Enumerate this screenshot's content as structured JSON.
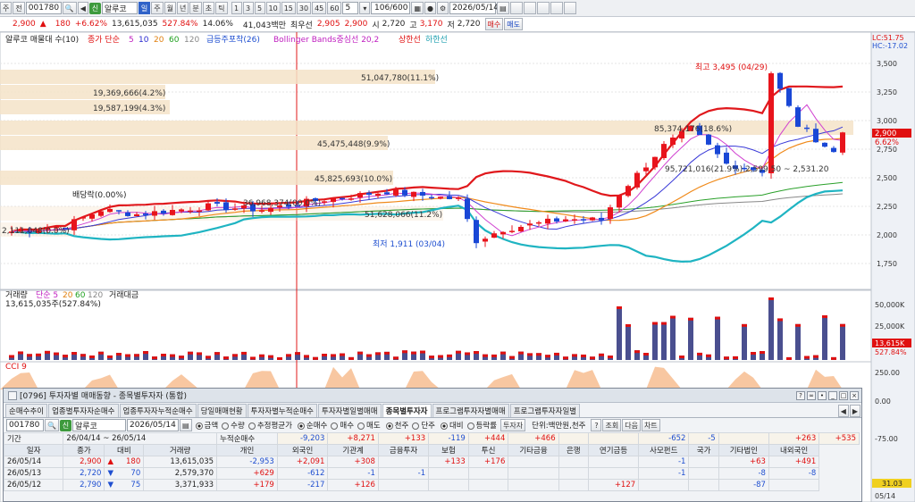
{
  "toolbar": {
    "code": "001780",
    "name": "알루코",
    "badge": "신",
    "period_tabs": [
      "일",
      "주",
      "월",
      "년",
      "분",
      "초",
      "틱"
    ],
    "minute_buttons": [
      "1",
      "3",
      "5",
      "10",
      "15",
      "30",
      "45",
      "60"
    ],
    "count": "5",
    "page": "106/600",
    "date": "2026/05/14",
    "buttons_left": [
      "주",
      "전"
    ]
  },
  "price": {
    "close": "2,900",
    "change_arrow": "▲",
    "change": "180",
    "change_pct": "+6.62%",
    "volume": "13,615,035",
    "vol_ratio": "527.84%",
    "turnover": "14.06%",
    "amount": "41,043백만",
    "label_low": "최우선",
    "bid": "2,905",
    "ask": "2,900",
    "open_label": "시",
    "open": "2,720",
    "high_label": "고",
    "high": "3,170",
    "low_label": "저",
    "low": "2,720",
    "buy_btn": "매수",
    "sell_btn": "매도"
  },
  "legend": {
    "main": "알루코 매물대 수(10)",
    "ma_label": "종가 단순",
    "ma": [
      "5",
      "10",
      "20",
      "60",
      "120"
    ],
    "ind1": "급등주포착(26)",
    "bb": "Bollinger Bands중심선 20,2",
    "bb_up": "상한선",
    "bb_dn": "하한선",
    "lc": "LC:51.75",
    "hc": "HC:-17.02"
  },
  "annotations": {
    "high": "최고 3,495 (04/29)",
    "low": "최저 1,911 (03/04)",
    "dividend": "배당락(0.00%)",
    "vp_line": "36,968,374(00.0%)",
    "zone_label": "95,721,016(21.9%) 2,599.50 ~ 2,531.20"
  },
  "volume_profile": [
    {
      "label": "51,047,780(11.1%)"
    },
    {
      "label": "19,369,666(4.2%)"
    },
    {
      "label": "19,587,199(4.3%)"
    },
    {
      "label": "85,374,176(18.6%)"
    },
    {
      "label": "45,475,448(9.9%)"
    },
    {
      "label": "45,825,693(10.0%)"
    },
    {
      "label": "51,628,066(11.2%)"
    },
    {
      "label": "2,111,048(0.0%)"
    }
  ],
  "price_axis": [
    "3,500",
    "3,250",
    "3,000",
    "2,750",
    "2,500",
    "2,250",
    "2,000",
    "1,750"
  ],
  "price_tags": {
    "cur": "2,900",
    "pct": "6.62%"
  },
  "vol_pane": {
    "label": "거래량",
    "ma": "단순 5",
    "ma2": "20",
    "ma3": "60",
    "ma4": "120",
    "amt": "거래대금",
    "value": "13,615,035주(527.84%)",
    "axis": [
      "50,000K",
      "25,000K"
    ],
    "tag": "13,615K",
    "tag2": "527.84%"
  },
  "cci_pane": {
    "label": "CCI 9",
    "axis": [
      "250.00",
      "0.00",
      "-75.00"
    ],
    "tag": "31.03",
    "date": "05/14"
  },
  "panel": {
    "id": "[0796]",
    "title": "투자자별 매매동향 - 종목별투자자 (통합)",
    "tabs": [
      "순매수추이",
      "업종별투자자순매수",
      "업종투자자누적순매수",
      "당일매매현황",
      "투자자별누적순매수",
      "투자자별일별매매",
      "종목별투자자",
      "프로그램투자자별매매",
      "프로그램투자자일별"
    ],
    "code": "001780",
    "name": "알루코",
    "date": "2026/05/14",
    "r1": [
      "금액",
      "수량",
      "추정평균가"
    ],
    "r2": [
      "순매수",
      "매수",
      "매도"
    ],
    "r3": [
      "천주",
      "단주"
    ],
    "r4": [
      "대비",
      "등락률"
    ],
    "inv_btn": "투자자",
    "unit": "단위:백만원,천주",
    "btns": [
      "?",
      "조회",
      "다음",
      "차트"
    ],
    "period_label": "기간",
    "from": "26/04/14",
    "to": "26/05/14",
    "cum_label": "누적순매수",
    "sums": [
      "-9,203",
      "+8,271",
      "+133",
      "-119",
      "+444",
      "+466",
      "",
      "",
      "-652",
      "-5",
      "",
      "+263",
      "+535"
    ],
    "headers": [
      "일자",
      "종가",
      "대비",
      "거래량",
      "개인",
      "외국인",
      "기관계",
      "금융투자",
      "보험",
      "투신",
      "기타금융",
      "은행",
      "연기금등",
      "사모펀드",
      "국가",
      "기타법인",
      "내외국인"
    ],
    "rows": [
      [
        "26/05/14",
        "2,900",
        "▲",
        "180",
        "13,615,035",
        "-2,953",
        "+2,091",
        "+308",
        "",
        "+133",
        "+176",
        "",
        "",
        "",
        "-1",
        "",
        "+63",
        "+491"
      ],
      [
        "26/05/13",
        "2,720",
        "▼",
        "70",
        "2,579,370",
        "+629",
        "-612",
        "-1",
        "-1",
        "",
        "",
        "",
        "",
        "",
        "-1",
        "",
        "-8",
        "-8"
      ],
      [
        "26/05/12",
        "2,790",
        "▼",
        "75",
        "3,371,933",
        "+179",
        "-217",
        "+126",
        "",
        "",
        "",
        "",
        "",
        "+127",
        "",
        "",
        "-87",
        ""
      ]
    ]
  },
  "colors": {
    "up": "#e8141c",
    "down": "#1947d6",
    "bb": "#1fb4c2",
    "ma5": "#e0181c",
    "ma10": "#3a3ad8",
    "ma20": "#f08a1a",
    "ma60": "#2aa02a",
    "ma120": "#888888",
    "vp": "#f5e3c8"
  }
}
